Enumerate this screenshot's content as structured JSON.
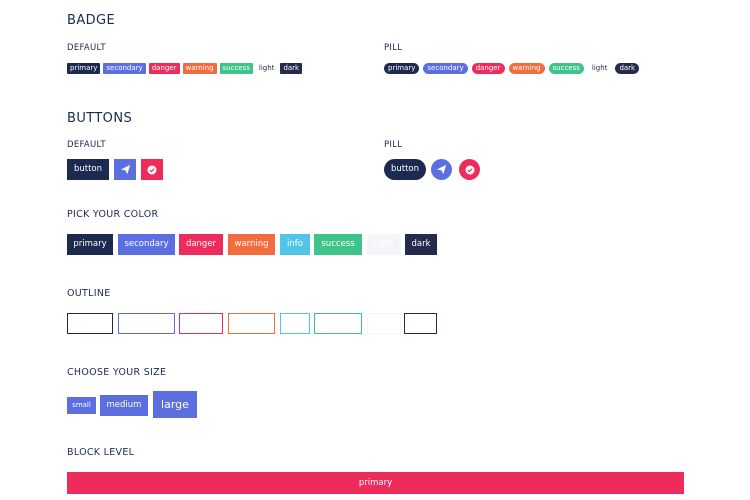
{
  "badge": {
    "title": "BADGE",
    "default_label": "DEFAULT",
    "pill_label": "PILL",
    "items": [
      "primary",
      "secondary",
      "danger",
      "warning",
      "success",
      "light",
      "dark"
    ]
  },
  "buttons": {
    "title": "BUTTONS",
    "default_label": "DEFAULT",
    "pill_label": "PILL",
    "button_label": "button",
    "icons": [
      "paper-plane-icon",
      "check-circle-icon"
    ]
  },
  "colors": {
    "title": "PICK YOUR COLOR",
    "items": [
      "primary",
      "secondary",
      "danger",
      "warning",
      "info",
      "success",
      "light",
      "dark"
    ]
  },
  "outline": {
    "title": "OUTLINE",
    "items": [
      "primary",
      "secondary",
      "danger",
      "warning",
      "info",
      "success",
      "light",
      "dark"
    ]
  },
  "size": {
    "title": "CHOOSE YOUR SIZE",
    "small": "small",
    "medium": "medium",
    "large": "large"
  },
  "block": {
    "title": "BLOCK LEVEL",
    "label": "primary"
  },
  "palette": {
    "primary": "#1b2a4e",
    "secondary": "#5c6fe0",
    "danger": "#ee2c5b",
    "warning": "#f36c3f",
    "info": "#51c4e8",
    "success": "#3ec48a",
    "light": "#f3f5f8",
    "dark": "#262a4d"
  }
}
